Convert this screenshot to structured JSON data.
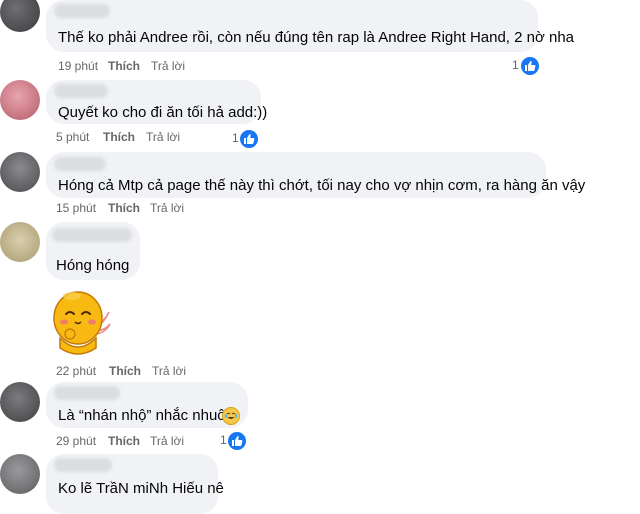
{
  "colors": {
    "bubble": "#f0f2f5",
    "meta_text": "#65676b",
    "like_blue": "#1877f2"
  },
  "comments": [
    {
      "text": "Thế ko phải Andree rồi, còn nếu đúng tên rap là Andree Right Hand, 2 nờ nha",
      "time": "19 phút",
      "like": "Thích",
      "reply": "Trả lời",
      "reactions": "1",
      "reaction_icon": "like-icon"
    },
    {
      "text": "Quyết ko cho đi ăn tối hả add:))",
      "time": "5 phút",
      "like": "Thích",
      "reply": "Trả lời",
      "reactions": "1",
      "reaction_icon": "like-icon"
    },
    {
      "text": "Hóng cả Mtp cả page thế này thì chớt, tối nay cho vợ nhịn cơm, ra hàng ăn vậy",
      "time": "15 phút",
      "like": "Thích",
      "reply": "Trả lời"
    },
    {
      "text": "Hóng hóng",
      "sticker": "yellow-blob-sticker",
      "time": "22 phút",
      "like": "Thích",
      "reply": "Trả lời"
    },
    {
      "text": "Là “nhán nhộ” nhắc nhuôn",
      "emoji": "crying-laughing-emoji",
      "time": "29 phút",
      "like": "Thích",
      "reply": "Trả lời",
      "reactions": "1",
      "reaction_icon": "like-icon"
    },
    {
      "text": "Ko lẽ TrầN miNh Hiếu nê"
    }
  ]
}
